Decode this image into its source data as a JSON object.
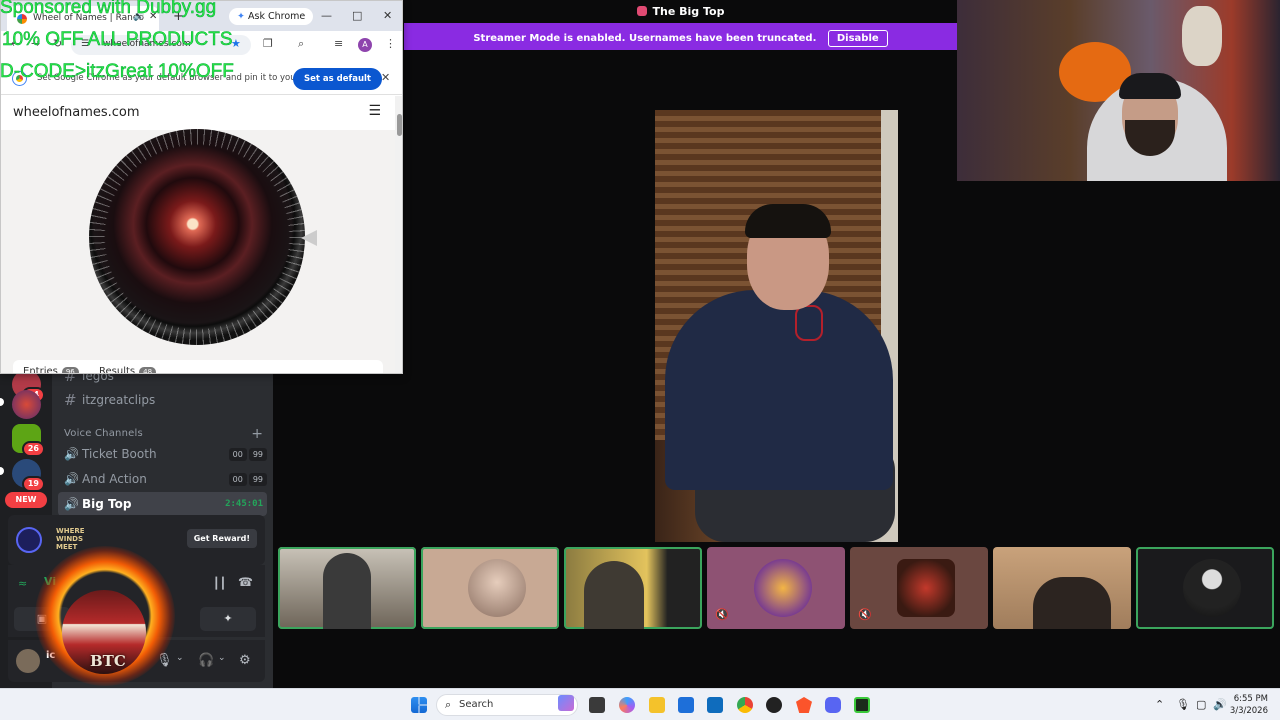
{
  "chrome": {
    "tab_title": "Wheel of Names | Rando",
    "ask_chrome": "Ask Chrome",
    "url": "wheelofnames.com",
    "avatar_initial": "A",
    "infobar_text": "Set Google Chrome as your default browser and pin it to your t...",
    "set_default_label": "Set as default",
    "page": {
      "site_name": "wheelofnames.com",
      "entries_label": "Entries",
      "entries_count": "96",
      "results_label": "Results",
      "results_count": "48"
    }
  },
  "overlay": {
    "line1": "Sponsored with Dubby.gg",
    "line2": "10% OFF ALL PRODUCTS",
    "line3": "D-CODE>itzGreat 10%OFF",
    "circus_text": "BTC"
  },
  "stage": {
    "title": "The Big Top",
    "streamer_notice": "Streamer Mode is enabled. Usernames have been truncated.",
    "disable_label": "Disable"
  },
  "servers": [
    {
      "badge": "84"
    },
    {
      "badge": ""
    },
    {
      "badge": "26"
    },
    {
      "badge": "19"
    }
  ],
  "new_badge": "NEW",
  "channels": {
    "text": [
      {
        "label": "legos"
      },
      {
        "label": "itzgreatclips"
      }
    ],
    "voice_category": "Voice Channels",
    "voice": [
      {
        "label": "Ticket Booth",
        "count_a": "00",
        "count_b": "99",
        "timer": ""
      },
      {
        "label": "And Action",
        "count_a": "00",
        "count_b": "99",
        "timer": ""
      },
      {
        "label": "Big Top",
        "count_a": "",
        "count_b": "",
        "timer": "2:45:01"
      }
    ]
  },
  "promo": {
    "title": "WHERE WINDS MEET",
    "button": "Get Reward!"
  },
  "voice_panel": {
    "status": "Vi"
  },
  "user_panel": {
    "name": "ic"
  },
  "taskbar": {
    "search_placeholder": "Search",
    "time": "6:55 PM",
    "date": "3/3/2026"
  },
  "colors": {
    "streamer_bar": "#8a2be2",
    "speaking_outline": "#3ba55d",
    "overlay_text": "#2ee84a",
    "chrome_blue": "#0b57d0"
  }
}
